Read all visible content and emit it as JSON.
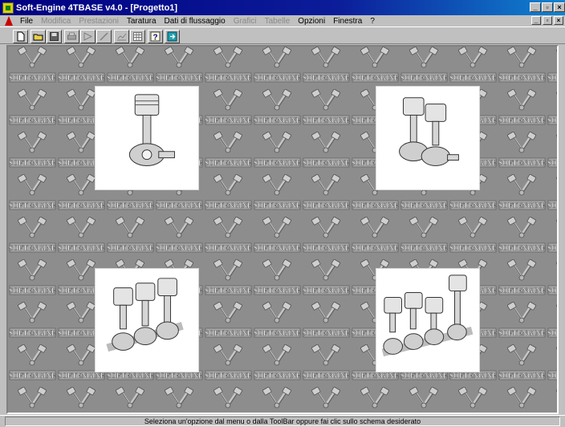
{
  "window": {
    "title": "Soft-Engine 4TBASE v4.0 - [Progetto1]",
    "controls": [
      "_",
      "▫",
      "×"
    ]
  },
  "menu": {
    "items": [
      {
        "label": "File",
        "enabled": true
      },
      {
        "label": "Modifica",
        "enabled": false
      },
      {
        "label": "Prestazioni",
        "enabled": false
      },
      {
        "label": "Taratura",
        "enabled": true
      },
      {
        "label": "Dati di flussaggio",
        "enabled": true
      },
      {
        "label": "Grafici",
        "enabled": false
      },
      {
        "label": "Tabelle",
        "enabled": false
      },
      {
        "label": "Opzioni",
        "enabled": true
      },
      {
        "label": "Finestra",
        "enabled": true
      },
      {
        "label": "?",
        "enabled": true
      }
    ],
    "mdi_controls": [
      "_",
      "▫",
      "×"
    ]
  },
  "toolbar": {
    "buttons": [
      {
        "name": "new-icon"
      },
      {
        "name": "open-folder-icon"
      },
      {
        "name": "save-icon"
      },
      {
        "name": "print-icon"
      },
      {
        "name": "run-icon"
      },
      {
        "name": "pen-icon"
      },
      {
        "name": "graph-icon"
      },
      {
        "name": "table-icon"
      },
      {
        "name": "help-icon"
      },
      {
        "name": "exit-icon"
      }
    ]
  },
  "background": {
    "tile_text": "SOFTENGINE"
  },
  "engines": [
    {
      "name": "engine-1-cylinder",
      "cylinders": 1
    },
    {
      "name": "engine-2-cylinder",
      "cylinders": 2
    },
    {
      "name": "engine-3-cylinder",
      "cylinders": 3
    },
    {
      "name": "engine-4-cylinder",
      "cylinders": 4
    }
  ],
  "status": {
    "text": "Seleziona un'opzione dal menu o dalla ToolBar oppure fai clic sullo schema desiderato"
  },
  "colors": {
    "title_bar": "#000080",
    "face": "#c0c0c0",
    "workspace": "#8d8d8d"
  }
}
